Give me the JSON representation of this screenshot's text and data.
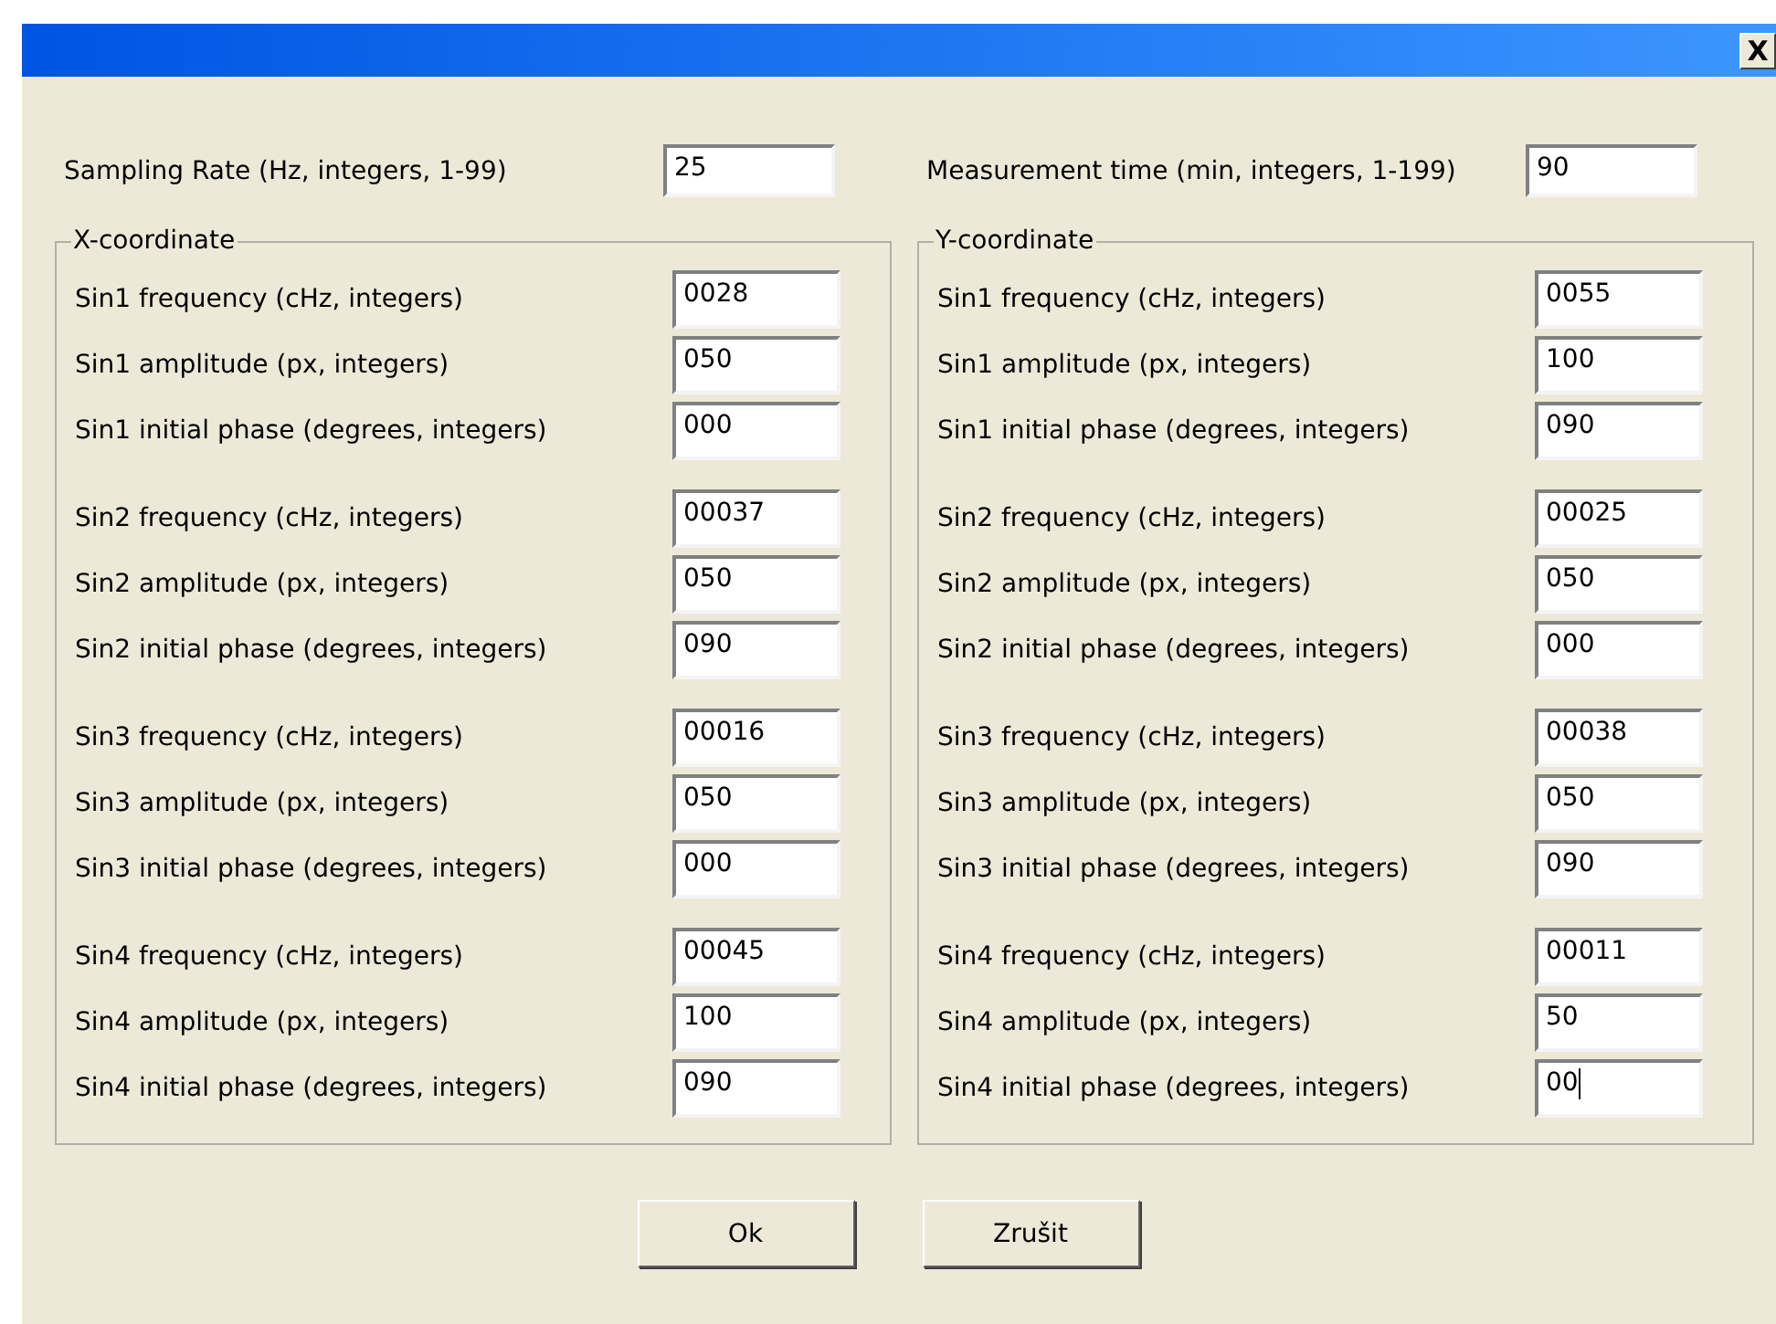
{
  "window": {
    "close": "X"
  },
  "top_fields": [
    {
      "label": "Sampling Rate (Hz, integers, 1-99)",
      "value": "25",
      "focused": false
    },
    {
      "label": "Measurement time (min, integers, 1-199)",
      "value": "90",
      "focused": false
    }
  ],
  "groups": [
    {
      "legend": "X-coordinate",
      "sections": [
        {
          "fields": [
            {
              "label": "Sin1 frequency (cHz, integers)",
              "value": "0028",
              "focused": false
            },
            {
              "label": "Sin1 amplitude (px, integers)",
              "value": "050",
              "focused": false
            },
            {
              "label": "Sin1 initial phase (degrees, integers)",
              "value": "000",
              "focused": false
            }
          ]
        },
        {
          "fields": [
            {
              "label": "Sin2 frequency (cHz, integers)",
              "value": "00037",
              "focused": false
            },
            {
              "label": "Sin2 amplitude (px, integers)",
              "value": "050",
              "focused": false
            },
            {
              "label": "Sin2 initial phase (degrees, integers)",
              "value": "090",
              "focused": false
            }
          ]
        },
        {
          "fields": [
            {
              "label": "Sin3 frequency (cHz, integers)",
              "value": "00016",
              "focused": false
            },
            {
              "label": "Sin3 amplitude (px, integers)",
              "value": "050",
              "focused": false
            },
            {
              "label": "Sin3 initial phase (degrees, integers)",
              "value": "000",
              "focused": false
            }
          ]
        },
        {
          "fields": [
            {
              "label": "Sin4 frequency (cHz, integers)",
              "value": "00045",
              "focused": false
            },
            {
              "label": "Sin4 amplitude (px, integers)",
              "value": "100",
              "focused": false
            },
            {
              "label": "Sin4 initial phase (degrees, integers)",
              "value": "090",
              "focused": false
            }
          ]
        }
      ]
    },
    {
      "legend": "Y-coordinate",
      "sections": [
        {
          "fields": [
            {
              "label": "Sin1 frequency (cHz, integers)",
              "value": "0055",
              "focused": false
            },
            {
              "label": "Sin1 amplitude (px, integers)",
              "value": "100",
              "focused": false
            },
            {
              "label": "Sin1 initial phase (degrees, integers)",
              "value": "090",
              "focused": false
            }
          ]
        },
        {
          "fields": [
            {
              "label": "Sin2 frequency (cHz, integers)",
              "value": "00025",
              "focused": false
            },
            {
              "label": "Sin2 amplitude (px, integers)",
              "value": "050",
              "focused": false
            },
            {
              "label": "Sin2 initial phase (degrees, integers)",
              "value": "000",
              "focused": false
            }
          ]
        },
        {
          "fields": [
            {
              "label": "Sin3 frequency (cHz, integers)",
              "value": "00038",
              "focused": false
            },
            {
              "label": "Sin3 amplitude (px, integers)",
              "value": "050",
              "focused": false
            },
            {
              "label": "Sin3 initial phase (degrees, integers)",
              "value": "090",
              "focused": false
            }
          ]
        },
        {
          "fields": [
            {
              "label": "Sin4 frequency (cHz, integers)",
              "value": "00011",
              "focused": false
            },
            {
              "label": "Sin4 amplitude (px, integers)",
              "value": "50",
              "focused": false
            },
            {
              "label": "Sin4 initial phase (degrees, integers)",
              "value": "00",
              "focused": true
            }
          ]
        }
      ]
    }
  ],
  "buttons": [
    "Ok",
    "Zrušit"
  ]
}
